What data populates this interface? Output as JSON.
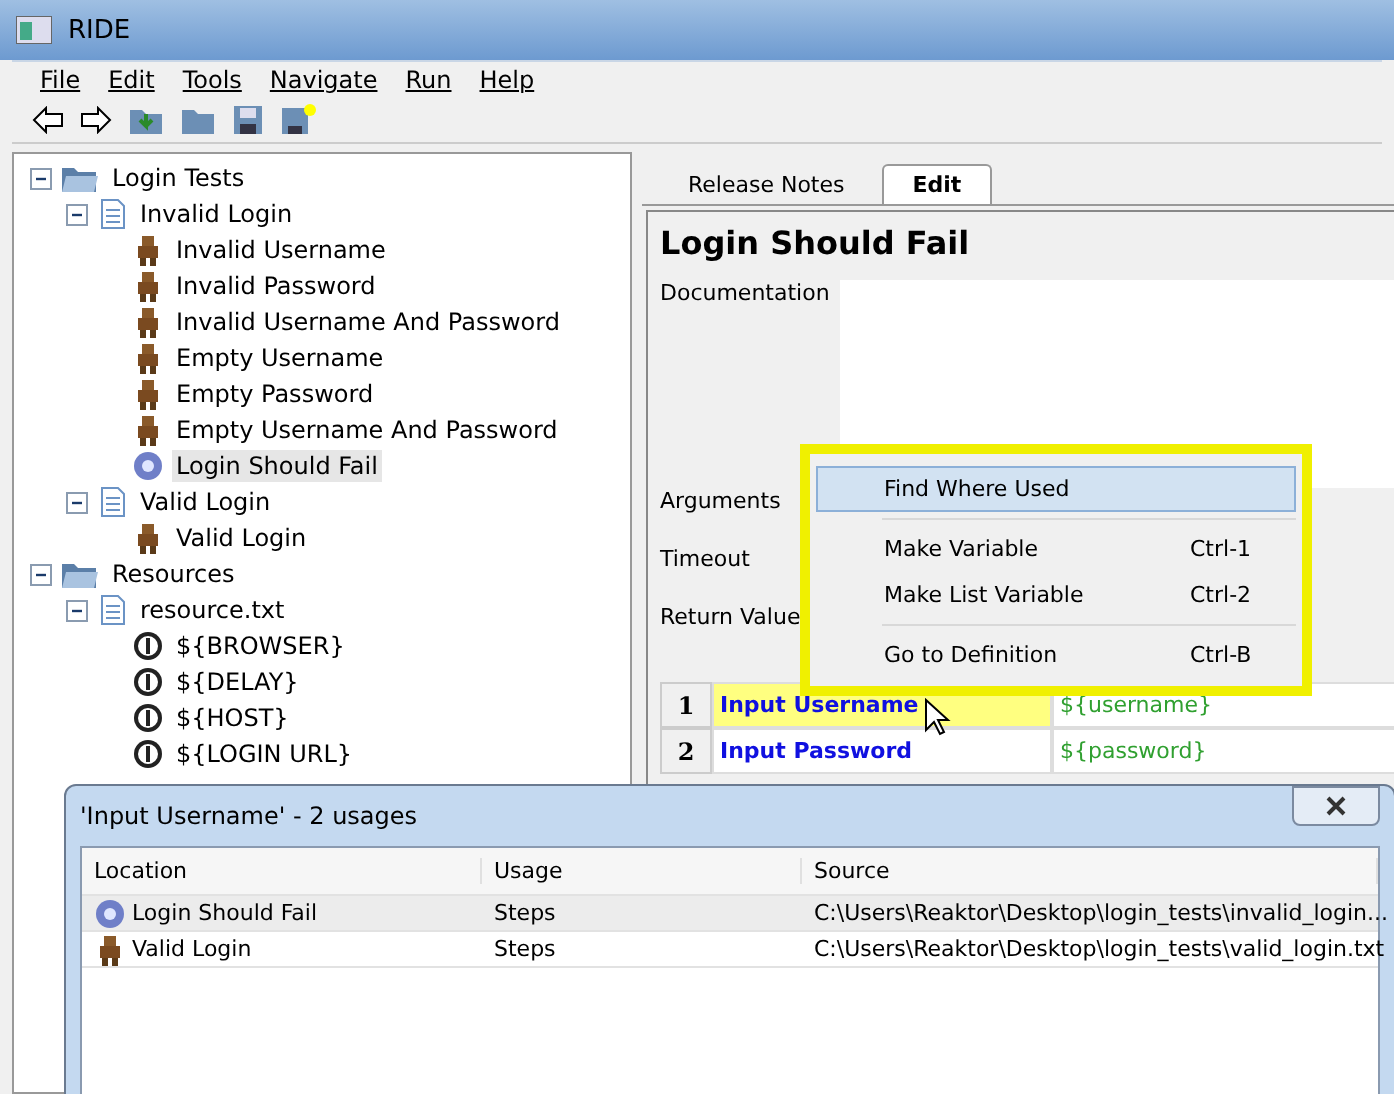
{
  "window": {
    "title": "RIDE"
  },
  "menu": [
    "File",
    "Edit",
    "Tools",
    "Navigate",
    "Run",
    "Help"
  ],
  "tree": [
    {
      "label": "Login Tests",
      "kind": "folder",
      "expanded": true,
      "selected": false,
      "children": [
        {
          "label": "Invalid Login",
          "kind": "file",
          "expanded": true,
          "selected": false,
          "children": [
            {
              "label": "Invalid Username",
              "kind": "test",
              "selected": false
            },
            {
              "label": "Invalid Password",
              "kind": "test",
              "selected": false
            },
            {
              "label": "Invalid Username And Password",
              "kind": "test",
              "selected": false
            },
            {
              "label": "Empty Username",
              "kind": "test",
              "selected": false
            },
            {
              "label": "Empty Password",
              "kind": "test",
              "selected": false
            },
            {
              "label": "Empty Username And Password",
              "kind": "test",
              "selected": false
            },
            {
              "label": "Login Should Fail",
              "kind": "keyword",
              "selected": true
            }
          ]
        },
        {
          "label": "Valid Login",
          "kind": "file",
          "expanded": true,
          "selected": false,
          "children": [
            {
              "label": "Valid Login",
              "kind": "test",
              "selected": false
            }
          ]
        }
      ]
    },
    {
      "label": "Resources",
      "kind": "folder",
      "expanded": true,
      "selected": false,
      "children": [
        {
          "label": "resource.txt",
          "kind": "file",
          "expanded": true,
          "selected": false,
          "children": [
            {
              "label": "${BROWSER}",
              "kind": "variable",
              "selected": false
            },
            {
              "label": "${DELAY}",
              "kind": "variable",
              "selected": false
            },
            {
              "label": "${HOST}",
              "kind": "variable",
              "selected": false
            },
            {
              "label": "${LOGIN URL}",
              "kind": "variable",
              "selected": false
            }
          ]
        }
      ]
    }
  ],
  "tabs": [
    {
      "label": "Release Notes",
      "selected": false
    },
    {
      "label": "Edit",
      "selected": true
    }
  ],
  "editor": {
    "title": "Login Should Fail",
    "fields": [
      "Documentation",
      "Arguments",
      "Timeout",
      "Return Value"
    ],
    "steps": [
      {
        "number": "1",
        "keyword": "Input Username",
        "argument": "${username}",
        "selected": true
      },
      {
        "number": "2",
        "keyword": "Input Password",
        "argument": "${password}",
        "selected": false
      }
    ]
  },
  "context_menu": {
    "groups": [
      [
        {
          "label": "Find Where Used",
          "selected": true
        }
      ],
      [
        {
          "label": "Make Variable",
          "shortcut": "Ctrl-1",
          "selected": false
        },
        {
          "label": "Make List Variable",
          "shortcut": "Ctrl-2",
          "selected": false
        }
      ],
      [
        {
          "label": "Go to Definition",
          "shortcut": "Ctrl-B",
          "selected": false
        }
      ]
    ]
  },
  "usages_dialog": {
    "title": "'Input Username' - 2 usages",
    "columns": [
      "Location",
      "Usage",
      "Source"
    ],
    "rows": [
      {
        "location": "Login Should Fail",
        "kind": "keyword",
        "usage": "Steps",
        "source": "C:\\Users\\Reaktor\\Desktop\\login_tests\\invalid_login...",
        "selected": true
      },
      {
        "location": "Valid Login",
        "kind": "test",
        "usage": "Steps",
        "source": "C:\\Users\\Reaktor\\Desktop\\login_tests\\valid_login.txt",
        "selected": false
      }
    ]
  }
}
